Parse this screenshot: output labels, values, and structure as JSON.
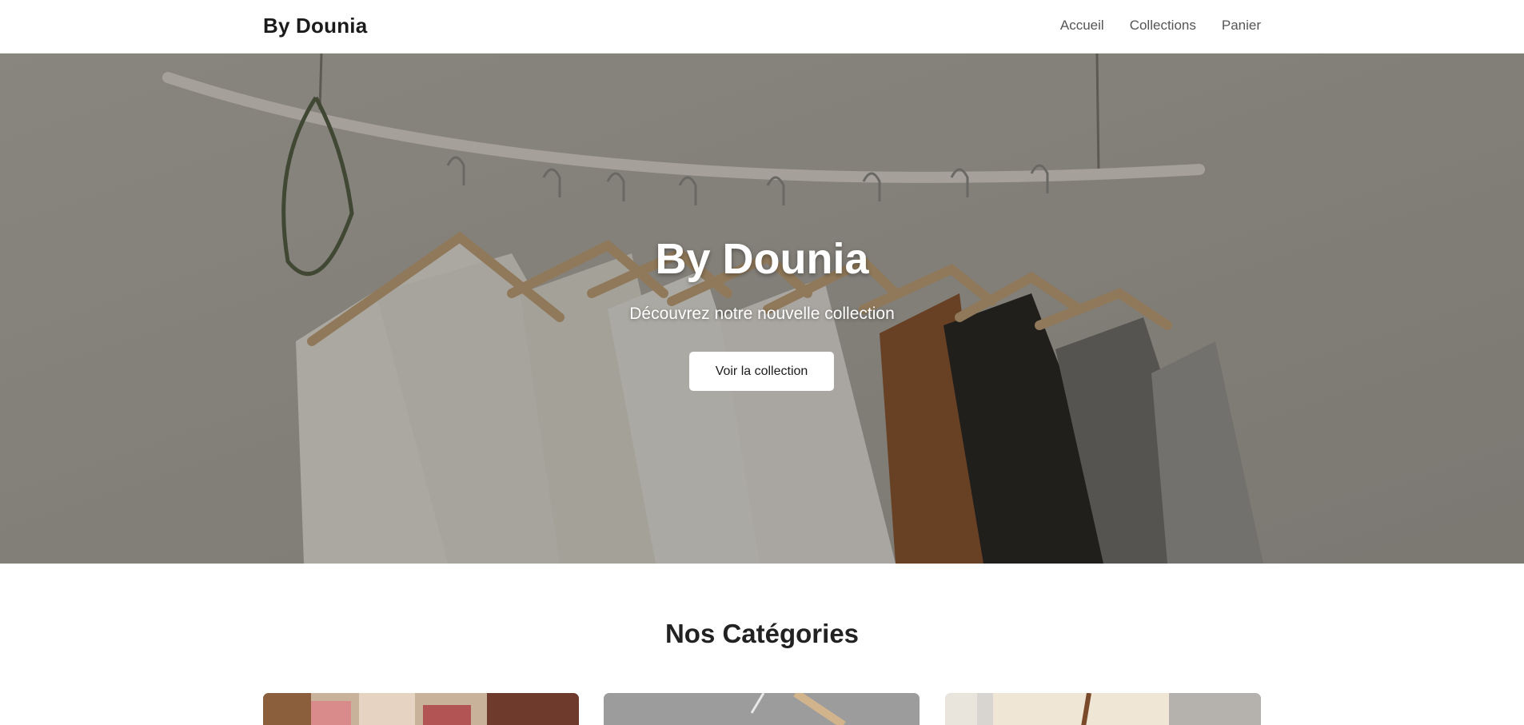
{
  "header": {
    "brand": "By Dounia",
    "nav": [
      {
        "label": "Accueil"
      },
      {
        "label": "Collections"
      },
      {
        "label": "Panier"
      }
    ]
  },
  "hero": {
    "title": "By Dounia",
    "subtitle": "Découvrez notre nouvelle collection",
    "cta_label": "Voir la collection"
  },
  "categories": {
    "title": "Nos Catégories"
  },
  "colors": {
    "text_dark": "#1b1b1b",
    "nav_text": "#555555",
    "hero_overlay": "#28242059",
    "button_bg": "#ffffff"
  }
}
